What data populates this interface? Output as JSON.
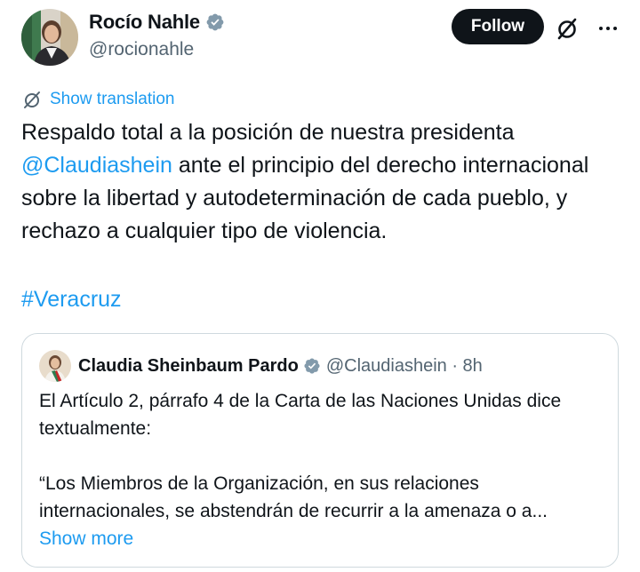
{
  "author": {
    "display_name": "Rocío Nahle",
    "handle": "@rocionahle"
  },
  "actions": {
    "follow_label": "Follow"
  },
  "translation": {
    "label": "Show translation"
  },
  "tweet": {
    "text_part1": "Respaldo total a la posición de nuestra presidenta ",
    "mention": "@Claudiashein",
    "text_part2": " ante el principio del derecho internacional sobre la libertad y autodeterminación de cada pueblo, y rechazo a cualquier tipo de violencia.",
    "hashtag": "#Veracruz"
  },
  "quoted_tweet": {
    "display_name": "Claudia Sheinbaum Pardo",
    "handle_time": "@Claudiashein · 8h",
    "paragraph1": "El Artículo 2, párrafo 4 de la Carta de las Naciones Unidas dice textualmente:",
    "paragraph2_line1": "“Los Miembros de la Organización, en sus relaciones",
    "paragraph2_line2": "internacionales, se abstendrán de recurrir a la amenaza o a...",
    "show_more": "Show more"
  },
  "colors": {
    "link": "#1d9bf0",
    "verified": "#829aab",
    "text": "#0f1419",
    "secondary": "#536471",
    "border": "#cfd9de"
  },
  "icons": [
    "verified-badge-icon",
    "grok-icon",
    "more-icon",
    "translate-icon"
  ]
}
